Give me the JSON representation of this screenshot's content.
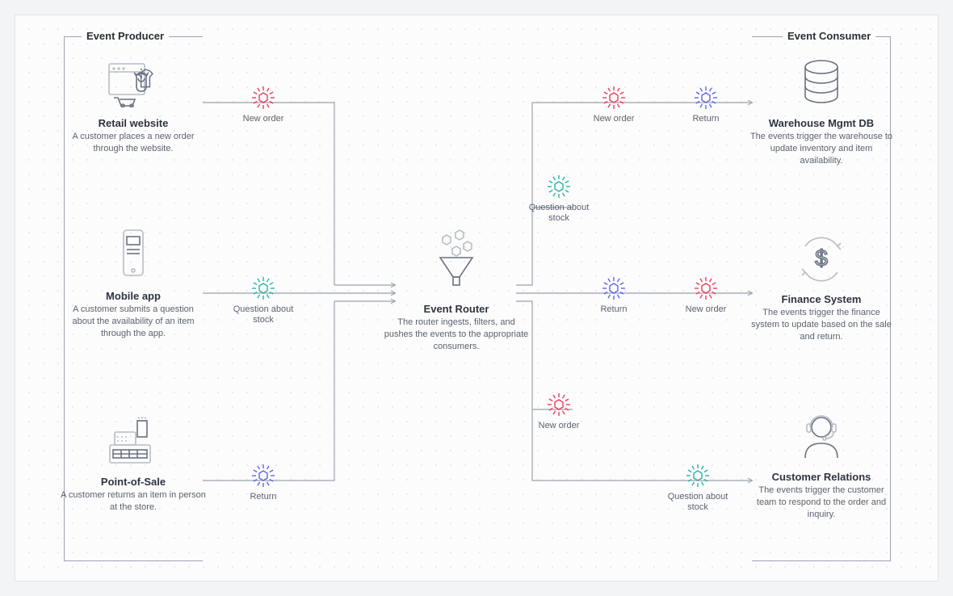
{
  "groups": {
    "producer": "Event Producer",
    "consumer": "Event Consumer"
  },
  "producers": {
    "retail": {
      "title": "Retail website",
      "desc": "A customer places a new order through the website."
    },
    "mobile": {
      "title": "Mobile app",
      "desc": "A customer submits a question about the availability of an item through the app."
    },
    "pos": {
      "title": "Point-of-Sale",
      "desc": "A customer returns an item in person at the store."
    }
  },
  "router": {
    "title": "Event Router",
    "desc": "The router ingests, filters, and pushes the events to the appropriate consumers."
  },
  "consumers": {
    "warehouse": {
      "title": "Warehouse Mgmt DB",
      "desc": "The events trigger the warehouse to update inventory and item availability."
    },
    "finance": {
      "title": "Finance System",
      "desc": "The events trigger the finance system to update based on the sale and return."
    },
    "cr": {
      "title": "Customer Relations",
      "desc": "The events trigger the customer team to respond to the order and inquiry."
    }
  },
  "events": {
    "new_order": "New order",
    "question": "Question about stock",
    "return": "Return"
  },
  "colors": {
    "red": "#E83E5B",
    "teal": "#26B5A3",
    "blue": "#5B67E8"
  }
}
